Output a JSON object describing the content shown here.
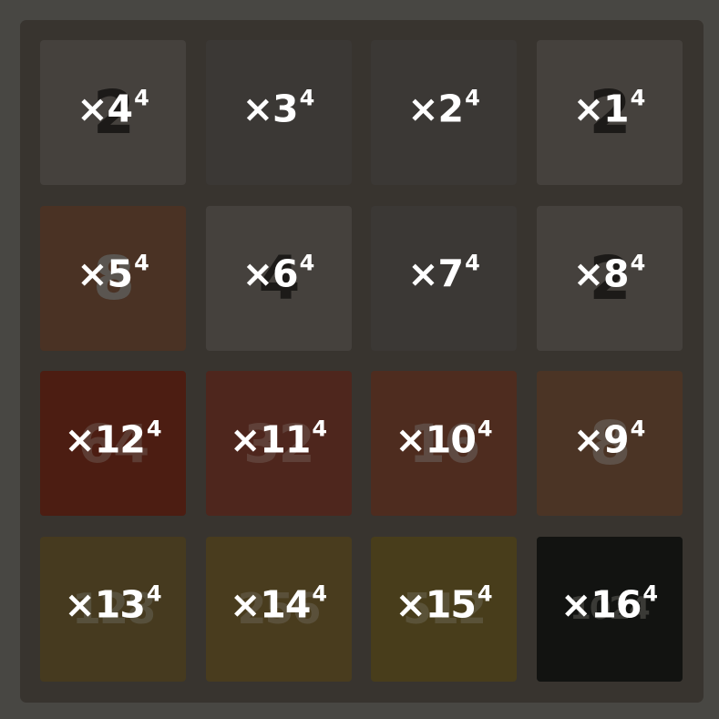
{
  "board": {
    "tiles": [
      {
        "value": "2",
        "label": "×4",
        "exp": "4",
        "bg": "#45413d",
        "fg": "#1c1a18",
        "size": 66
      },
      {
        "value": "",
        "label": "×3",
        "exp": "4",
        "bg": "#3b3835",
        "fg": "#1c1a18",
        "size": 66
      },
      {
        "value": "",
        "label": "×2",
        "exp": "4",
        "bg": "#3b3835",
        "fg": "#1c1a18",
        "size": 66
      },
      {
        "value": "2",
        "label": "×1",
        "exp": "4",
        "bg": "#45413d",
        "fg": "#1c1a18",
        "size": 66
      },
      {
        "value": "8",
        "label": "×5",
        "exp": "4",
        "bg": "#4a3224",
        "fg": "#5a5550",
        "size": 66
      },
      {
        "value": "4",
        "label": "×6",
        "exp": "4",
        "bg": "#45413d",
        "fg": "#1c1a18",
        "size": 66
      },
      {
        "value": "",
        "label": "×7",
        "exp": "4",
        "bg": "#3b3835",
        "fg": "#1c1a18",
        "size": 66
      },
      {
        "value": "2",
        "label": "×8",
        "exp": "4",
        "bg": "#45413d",
        "fg": "#1c1a18",
        "size": 66
      },
      {
        "value": "64",
        "label": "×12",
        "exp": "4",
        "bg": "#4c1d12",
        "fg": "#5d3c33",
        "size": 58
      },
      {
        "value": "32",
        "label": "×11",
        "exp": "4",
        "bg": "#4e261d",
        "fg": "#5f4038",
        "size": 58
      },
      {
        "value": "16",
        "label": "×10",
        "exp": "4",
        "bg": "#4e2c1f",
        "fg": "#5e4a42",
        "size": 58
      },
      {
        "value": "8",
        "label": "×9",
        "exp": "4",
        "bg": "#4b3425",
        "fg": "#5e5148",
        "size": 66
      },
      {
        "value": "128",
        "label": "×13",
        "exp": "4",
        "bg": "#463a1f",
        "fg": "#57503c",
        "size": 46
      },
      {
        "value": "256",
        "label": "×14",
        "exp": "4",
        "bg": "#493c1e",
        "fg": "#5a503a",
        "size": 46
      },
      {
        "value": "512",
        "label": "×15",
        "exp": "4",
        "bg": "#483d1b",
        "fg": "#5a5238",
        "size": 46
      },
      {
        "value": "1024",
        "label": "×16",
        "exp": "4",
        "bg": "#121311",
        "fg": "#3a3a36",
        "size": 34
      }
    ]
  }
}
